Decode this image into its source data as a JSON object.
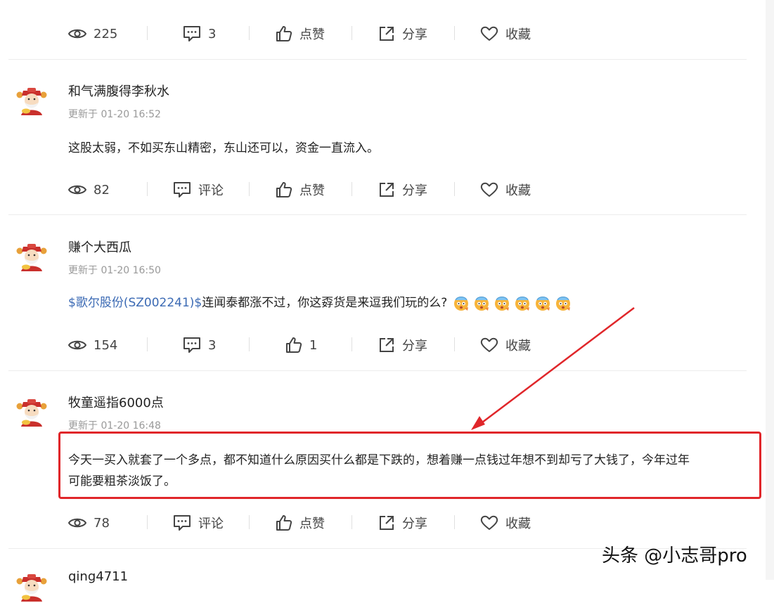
{
  "actions_labels": {
    "comment": "评论",
    "like": "点赞",
    "share": "分享",
    "favorite": "收藏"
  },
  "posts": [
    {
      "views": "225",
      "comments": "3",
      "like": "点赞",
      "share": "分享",
      "favorite": "收藏"
    },
    {
      "username": "和气满腹得李秋水",
      "time": "更新于 01-20 16:52",
      "content": "这股太弱，不如买东山精密，东山还可以，资金一直流入。",
      "views": "82",
      "comments": "评论",
      "like": "点赞",
      "share": "分享",
      "favorite": "收藏"
    },
    {
      "username": "赚个大西瓜",
      "time": "更新于 01-20 16:50",
      "stock_link": "$歌尔股份(SZ002241)$",
      "content": "连闻泰都涨不过，你这孬货是来逗我们玩的么?",
      "emoji_count": 6,
      "views": "154",
      "comments": "3",
      "like": "1",
      "share": "分享",
      "favorite": "收藏"
    },
    {
      "username": "牧童遥指6000点",
      "time": "更新于 01-20 16:48",
      "content_line1": "今天一买入就套了一个多点，都不知道什么原因买什么都是下跌的，想着赚一点钱过年想不到却亏了大钱了，今年过年",
      "content_line2": "可能要粗茶淡饭了。",
      "views": "78",
      "comments": "评论",
      "like": "点赞",
      "share": "分享",
      "favorite": "收藏"
    },
    {
      "username": "qing4711"
    }
  ],
  "watermark": "头条 @小志哥pro",
  "colors": {
    "link": "#3b6ab4",
    "highlight": "#e0262a",
    "muted": "#999999"
  }
}
